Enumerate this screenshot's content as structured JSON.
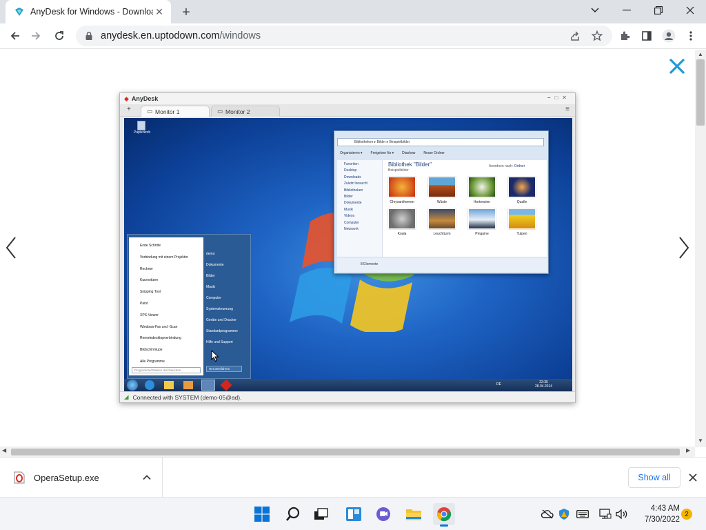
{
  "browser": {
    "tab_title": "AnyDesk for Windows - Downloa",
    "url_host": "anydesk.en.uptodown.com",
    "url_path": "/windows"
  },
  "screenshot": {
    "window_title": "AnyDesk",
    "tabs": [
      "Monitor 1",
      "Monitor 2"
    ],
    "status": "Connected with SYSTEM (demo-05@ad).",
    "explorer": {
      "path": "Bibliotheken ▸ Bilder ▸ Beispielbilder",
      "title": "Bibliothek \"Bilder\"",
      "subtitle": "Beispielbilder",
      "arrange_label": "Anordnen nach:",
      "arrange_value": "Ordner",
      "toolbar": [
        "Organisieren ▾",
        "Freigeben für ▾",
        "Diashow",
        "Neuer Ordner"
      ],
      "nav": [
        "Favoriten",
        "Desktop",
        "Downloads",
        "Zuletzt besucht",
        "Bibliotheken",
        "Bilder",
        "Dokumente",
        "Musik",
        "Videos",
        "Computer",
        "Netzwerk"
      ],
      "images": [
        "Chrysanthemen",
        "Wüste",
        "Hortensien",
        "Qualle",
        "Koala",
        "Leuchtturm",
        "Pinguine",
        "Tulpen"
      ],
      "count": "8 Elemente"
    },
    "startmenu": {
      "left": [
        "Erste Schritte",
        "Verbindung mit einem Projektor",
        "Rechner",
        "Kurznotizen",
        "Snipping Tool",
        "Paint",
        "XPS-Viewer",
        "Windows-Fax und -Scan",
        "Remotedesktopverbindung",
        "Bildschirmlupe",
        "Alle Programme"
      ],
      "search": "Programme/Dateien durchsuchen",
      "right": [
        "demo",
        "Dokumente",
        "Bilder",
        "Musik",
        "Computer",
        "Systemsteuerung",
        "Geräte und Drucker",
        "Standardprogramme",
        "Hilfe und Support"
      ],
      "shutdown": "Herunterfahren"
    },
    "desktop_icon": "Papierkorb",
    "clock_time": "22:35",
    "clock_date": "28.04.2014",
    "lang": "DE"
  },
  "downloads": {
    "file": "OperaSetup.exe",
    "show_all": "Show all"
  },
  "taskbar": {
    "time": "4:43 AM",
    "date": "7/30/2022",
    "notifications": "2"
  }
}
